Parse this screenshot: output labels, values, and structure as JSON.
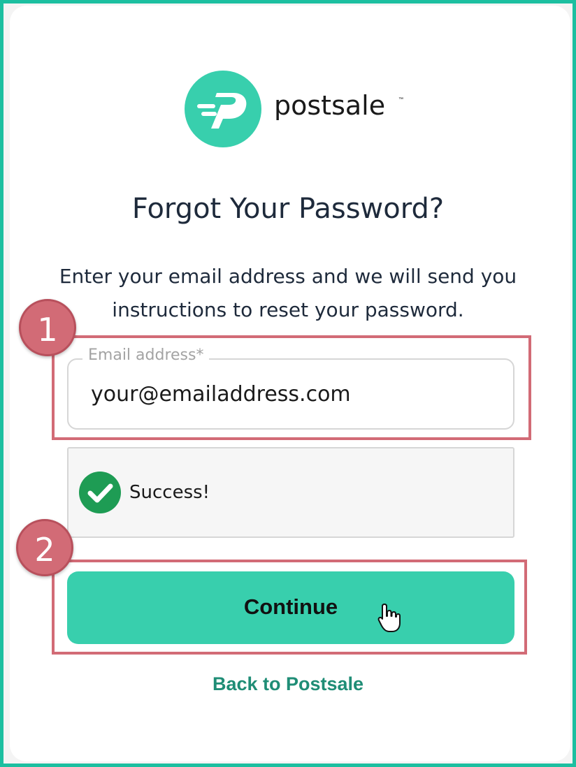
{
  "brand": {
    "name": "postsale",
    "trademark": "™",
    "icon": "postsale-logo-icon",
    "color": "#38cfad"
  },
  "page": {
    "title": "Forgot Your Password?",
    "instructions": "Enter your email address and we will send you instructions to reset your password."
  },
  "form": {
    "email_label": "Email address*",
    "email_value": "your@emailaddress.com"
  },
  "status": {
    "icon": "check-circle-icon",
    "text": "Success!",
    "color": "#1e9c54"
  },
  "actions": {
    "continue_label": "Continue",
    "back_link": "Back to Postsale"
  },
  "annotations": {
    "steps": [
      "1",
      "2"
    ],
    "highlight_color": "#d26b76"
  }
}
